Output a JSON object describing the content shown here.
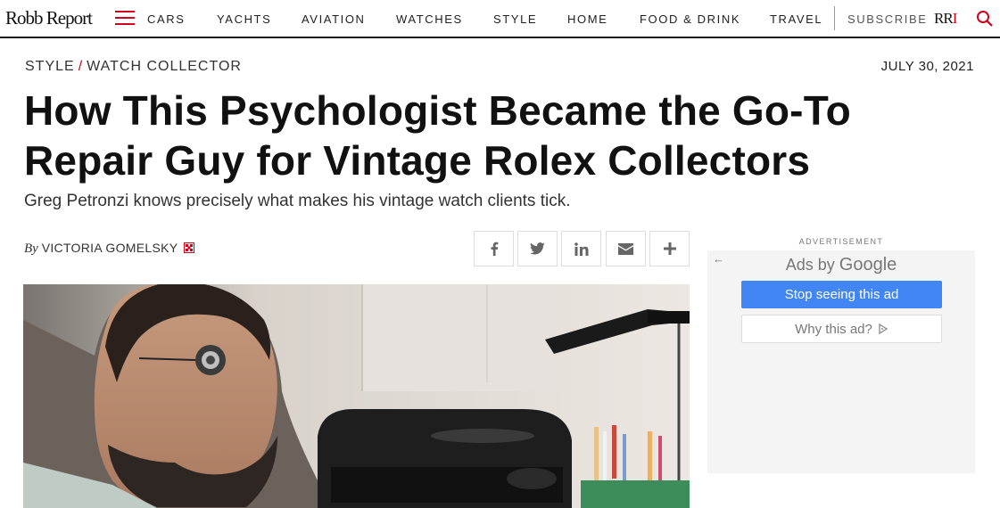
{
  "brand": {
    "logo": "Robb Report",
    "mark_left": "RR",
    "mark_right": "I"
  },
  "nav": {
    "items": [
      "CARS",
      "YACHTS",
      "AVIATION",
      "WATCHES",
      "STYLE",
      "HOME",
      "FOOD & DRINK",
      "TRAVEL"
    ],
    "subscribe": "SUBSCRIBE"
  },
  "article": {
    "breadcrumb": [
      "STYLE",
      "WATCH COLLECTOR"
    ],
    "breadcrumb_sep": "/",
    "date": "JULY 30, 2021",
    "headline": "How This Psychologist Became the Go-To Repair Guy for Vintage Rolex Collectors",
    "dek": "Greg Petronzi knows precisely what makes his vintage watch clients tick.",
    "byline_prefix": "By",
    "author": "VICTORIA GOMELSKY"
  },
  "share": [
    "facebook-icon",
    "twitter-icon",
    "linkedin-icon",
    "email-icon",
    "plus-icon"
  ],
  "ad": {
    "label": "ADVERTISEMENT",
    "ads_by": "Ads by",
    "google": "Google",
    "stop": "Stop seeing this ad",
    "why": "Why this ad?"
  },
  "colors": {
    "accent": "#d0021b",
    "ad_button": "#4285f4"
  }
}
